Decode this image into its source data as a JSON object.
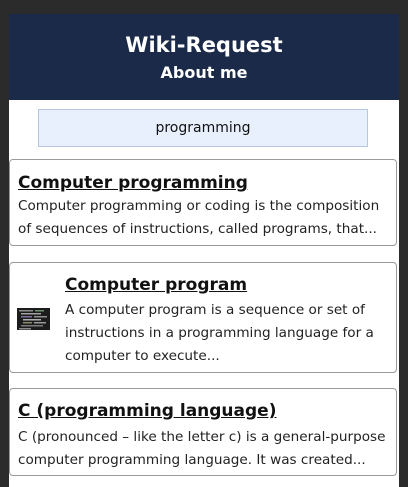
{
  "header": {
    "title": "Wiki-Request",
    "subtitle": "About me"
  },
  "search": {
    "value": "programming"
  },
  "results": [
    {
      "title": "Computer programming",
      "snippet": "Computer programming or coding is the composition of sequences of instructions, called programs, that..."
    },
    {
      "title": "Computer program",
      "snippet": "A computer program is a sequence or set of instructions in a programming language for a computer to execute...",
      "thumbnail": "source-code-thumbnail"
    },
    {
      "title": "C (programming language)",
      "snippet": "C (pronounced – like the letter c) is a general-purpose computer programming language. It was created..."
    }
  ],
  "colors": {
    "header_bg": "#1b2a48",
    "page_bg": "#2b2b2b",
    "search_bg": "#e8f0fe"
  }
}
